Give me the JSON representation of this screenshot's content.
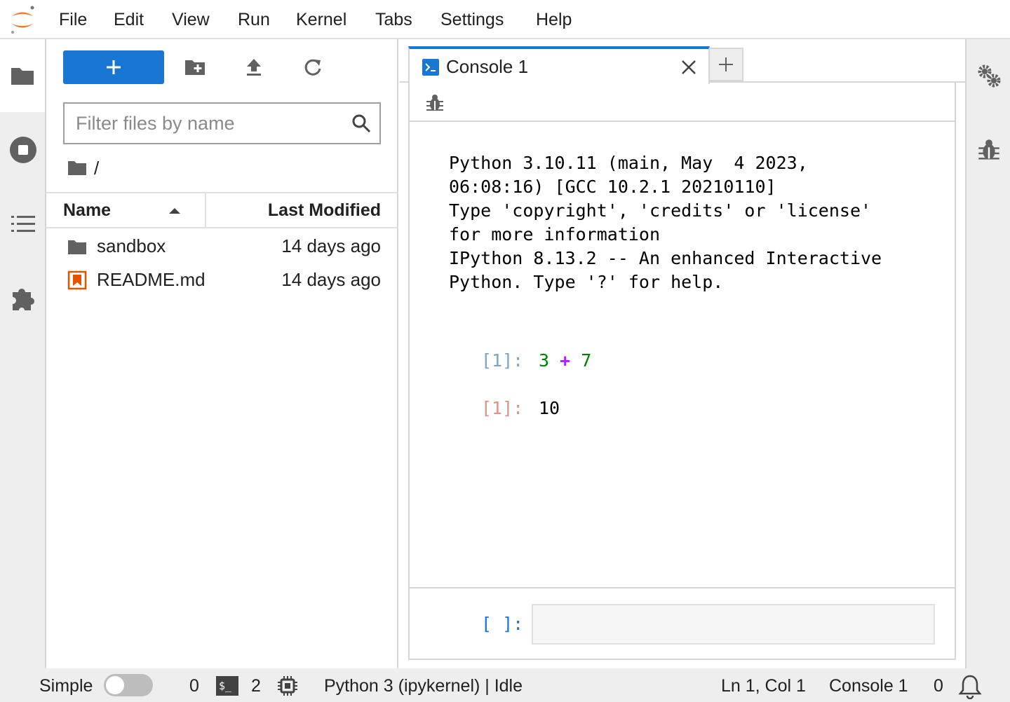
{
  "menu": {
    "items": [
      "File",
      "Edit",
      "View",
      "Run",
      "Kernel",
      "Tabs",
      "Settings",
      "Help"
    ]
  },
  "filebrowser": {
    "filter_placeholder": "Filter files by name",
    "breadcrumb": "/",
    "columns": {
      "name": "Name",
      "modified": "Last Modified"
    },
    "files": [
      {
        "name": "sandbox",
        "modified": "14 days ago",
        "type": "folder"
      },
      {
        "name": "README.md",
        "modified": "14 days ago",
        "type": "markdown"
      }
    ]
  },
  "tabs": {
    "active_label": "Console 1"
  },
  "console": {
    "banner": "Python 3.10.11 (main, May  4 2023,\n06:08:16) [GCC 10.2.1 20210110]\nType 'copyright', 'credits' or 'license'\nfor more information\nIPython 8.13.2 -- An enhanced Interactive\nPython. Type '?' for help.",
    "cells": [
      {
        "in_prompt": "[1]:",
        "code": {
          "left": "3",
          "op": "+",
          "right": "7"
        },
        "out_prompt": "[1]:",
        "output": "10"
      }
    ],
    "empty_prompt": "[ ]:"
  },
  "statusbar": {
    "mode_label": "Simple",
    "mode_enabled": false,
    "terminals_count": "0",
    "terminal_icon_glyph": "$_",
    "kernels_count": "2",
    "kernel_status": "Python 3 (ipykernel) | Idle",
    "cursor_position": "Ln 1, Col 1",
    "active_doc": "Console 1",
    "notifications_count": "0"
  },
  "colors": {
    "brand": "#1976d2",
    "logo_orange": "#f37726",
    "number_green": "#008000",
    "operator_purple": "#aa22ff",
    "in_prompt": "#7ba5c7",
    "out_prompt": "#d9938a",
    "markdown_icon": "#e65100"
  }
}
